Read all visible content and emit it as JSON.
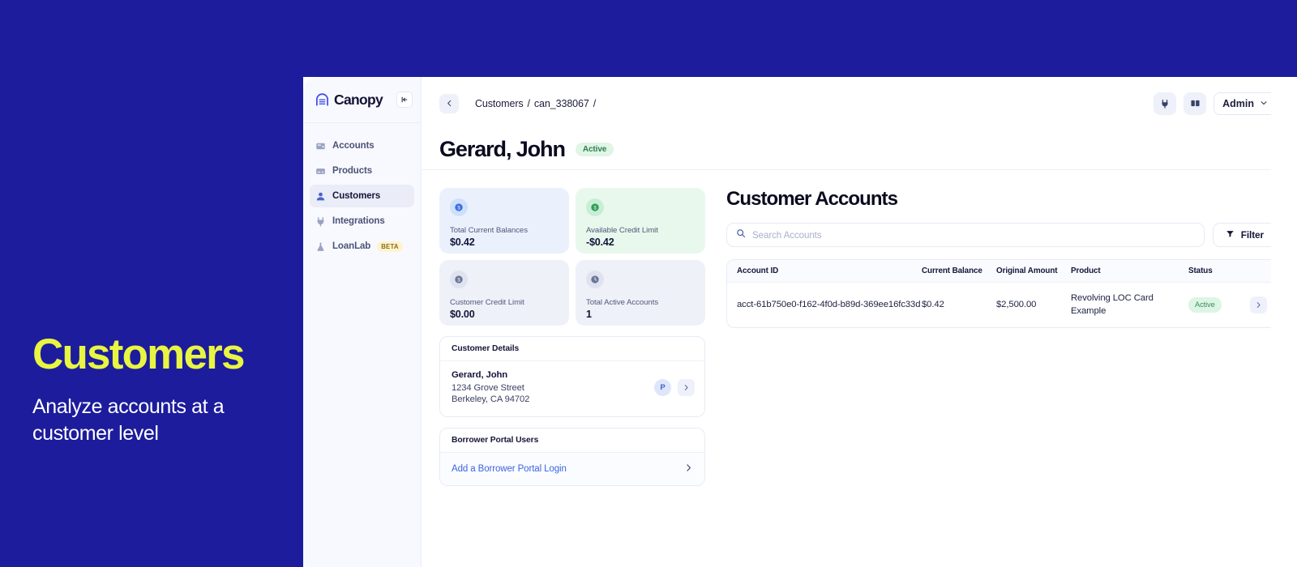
{
  "promo": {
    "title": "Customers",
    "subtitle": "Analyze accounts at a customer level",
    "title_color": "#e8f542",
    "bg_color": "#1c1c9c"
  },
  "sidebar": {
    "brand": "Canopy",
    "brand_mark_icon": "canopy-arch-logo",
    "collapse_icon": "collapse-sidebar-icon",
    "items": [
      {
        "label": "Accounts",
        "icon": "wallet-icon",
        "active": false,
        "badge": ""
      },
      {
        "label": "Products",
        "icon": "card-icon",
        "active": false,
        "badge": ""
      },
      {
        "label": "Customers",
        "icon": "person-icon",
        "active": true,
        "badge": ""
      },
      {
        "label": "Integrations",
        "icon": "plug-icon",
        "active": false,
        "badge": ""
      },
      {
        "label": "LoanLab",
        "icon": "flask-icon",
        "active": false,
        "badge": "BETA"
      }
    ]
  },
  "topbar": {
    "back_icon": "chevron-left-icon",
    "breadcrumb": {
      "root": "Customers",
      "sep1": "/",
      "id": "can_338067",
      "sep2": "/"
    },
    "integrations_icon": "plug-icon",
    "docs_icon": "book-icon",
    "account_label": "Admin",
    "account_chevron_icon": "chevron-down-icon"
  },
  "header": {
    "title": "Gerard, John",
    "status_badge": "Active",
    "status_color": "#2f7d4f"
  },
  "stats": [
    {
      "label": "Total Current Balances",
      "value": "$0.42",
      "tone": "blue",
      "icon": "dollar-circle-icon"
    },
    {
      "label": "Available Credit Limit",
      "value": "-$0.42",
      "tone": "green",
      "icon": "dollar-circle-icon"
    },
    {
      "label": "Customer Credit Limit",
      "value": "$0.00",
      "tone": "grey",
      "icon": "dollar-circle-icon"
    },
    {
      "label": "Total Active Accounts",
      "value": "1",
      "tone": "grey",
      "icon": "clock-icon"
    }
  ],
  "customer_details": {
    "heading": "Customer Details",
    "name": "Gerard, John",
    "address_line1": "1234 Grove Street",
    "address_line2": "Berkeley, CA 94702",
    "avatar_initial": "P",
    "chevron_icon": "chevron-right-icon"
  },
  "borrower_portal": {
    "heading": "Borrower Portal Users",
    "link": "Add a Borrower Portal Login",
    "link_color": "#3b64e0",
    "chevron_icon": "chevron-right-icon"
  },
  "accounts": {
    "section_title": "Customer Accounts",
    "search_placeholder": "Search Accounts",
    "search_value": "",
    "search_icon": "search-icon",
    "filter_label": "Filter",
    "filter_icon": "funnel-icon",
    "columns": [
      "Account ID",
      "Current Balance",
      "Original Amount",
      "Product",
      "Status",
      ""
    ],
    "rows": [
      {
        "account_id": "acct-61b750e0-f162-4f0d-b89d-369ee16fc33d",
        "current_balance": "$0.42",
        "original_amount": "$2,500.00",
        "product": "Revolving LOC Card Example",
        "status": "Active",
        "chevron_icon": "chevron-right-icon"
      }
    ]
  }
}
